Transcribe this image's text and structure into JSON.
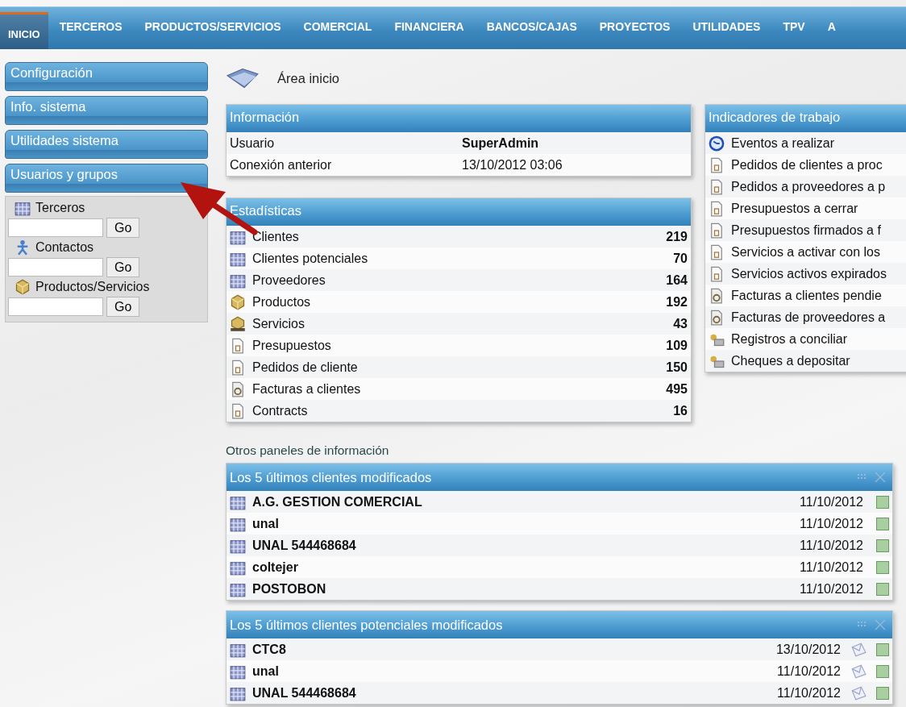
{
  "nav": {
    "tabs": [
      {
        "label": "INICIO",
        "selected": true
      },
      {
        "label": "TERCEROS",
        "selected": false
      },
      {
        "label": "PRODUCTOS/SERVICIOS",
        "selected": false
      },
      {
        "label": "COMERCIAL",
        "selected": false
      },
      {
        "label": "FINANCIERA",
        "selected": false
      },
      {
        "label": "BANCOS/CAJAS",
        "selected": false
      },
      {
        "label": "PROYECTOS",
        "selected": false
      },
      {
        "label": "UTILIDADES",
        "selected": false
      },
      {
        "label": "TPV",
        "selected": false
      },
      {
        "label": "A",
        "selected": false
      }
    ]
  },
  "sidebar": {
    "menu": [
      "Configuración",
      "Info. sistema",
      "Utilidades sistema",
      "Usuarios y grupos"
    ],
    "search": [
      {
        "kind": "company",
        "label": "Terceros",
        "button": "Go"
      },
      {
        "kind": "contact",
        "label": "Contactos",
        "button": "Go"
      },
      {
        "kind": "product",
        "label": "Productos/Servicios",
        "button": "Go"
      }
    ]
  },
  "page_title": "Área inicio",
  "info": {
    "title": "Información",
    "rows": [
      {
        "label": "Usuario",
        "value": "SuperAdmin",
        "bold": true
      },
      {
        "label": "Conexión anterior",
        "value": "13/10/2012 03:06",
        "bold": false
      }
    ]
  },
  "stats": {
    "title": "Estadísticas",
    "rows": [
      {
        "kind": "company",
        "label": "Clientes",
        "value": "219"
      },
      {
        "kind": "company",
        "label": "Clientes potenciales",
        "value": "70"
      },
      {
        "kind": "company",
        "label": "Proveedores",
        "value": "164"
      },
      {
        "kind": "product",
        "label": "Productos",
        "value": "192"
      },
      {
        "kind": "service",
        "label": "Servicios",
        "value": "43"
      },
      {
        "kind": "doc",
        "label": "Presupuestos",
        "value": "109"
      },
      {
        "kind": "doc",
        "label": "Pedidos de cliente",
        "value": "150"
      },
      {
        "kind": "invoice",
        "label": "Facturas a clientes",
        "value": "495"
      },
      {
        "kind": "doc",
        "label": "Contracts",
        "value": "16"
      }
    ]
  },
  "indicators": {
    "title": "Indicadores de trabajo",
    "items": [
      {
        "kind": "clock",
        "label": "Eventos a realizar"
      },
      {
        "kind": "doc",
        "label": "Pedidos de clientes a proc"
      },
      {
        "kind": "doc",
        "label": "Pedidos a proveedores a p"
      },
      {
        "kind": "doc",
        "label": "Presupuestos a cerrar"
      },
      {
        "kind": "doc",
        "label": "Presupuestos firmados a f"
      },
      {
        "kind": "doc",
        "label": "Servicios a activar con los"
      },
      {
        "kind": "doc",
        "label": "Servicios activos expirados"
      },
      {
        "kind": "invoice",
        "label": "Facturas a clientes pendie"
      },
      {
        "kind": "invoice",
        "label": "Facturas de proveedores a"
      },
      {
        "kind": "bank",
        "label": "Registros a conciliar"
      },
      {
        "kind": "bank",
        "label": "Cheques a depositar"
      }
    ]
  },
  "other_heading": "Otros paneles de información",
  "panels": [
    {
      "title": "Los 5 últimos clientes modificados",
      "show_email": false,
      "rows": [
        {
          "name": "A.G. GESTION COMERCIAL",
          "date": "11/10/2012"
        },
        {
          "name": "unal",
          "date": "11/10/2012"
        },
        {
          "name": "UNAL 544468684",
          "date": "11/10/2012"
        },
        {
          "name": "coltejer",
          "date": "11/10/2012"
        },
        {
          "name": "POSTOBON",
          "date": "11/10/2012"
        }
      ]
    },
    {
      "title": "Los 5 últimos clientes potenciales modificados",
      "show_email": true,
      "rows": [
        {
          "name": "CTC8",
          "date": "13/10/2012"
        },
        {
          "name": "unal",
          "date": "11/10/2012"
        },
        {
          "name": "UNAL 544468684",
          "date": "11/10/2012"
        }
      ]
    }
  ]
}
